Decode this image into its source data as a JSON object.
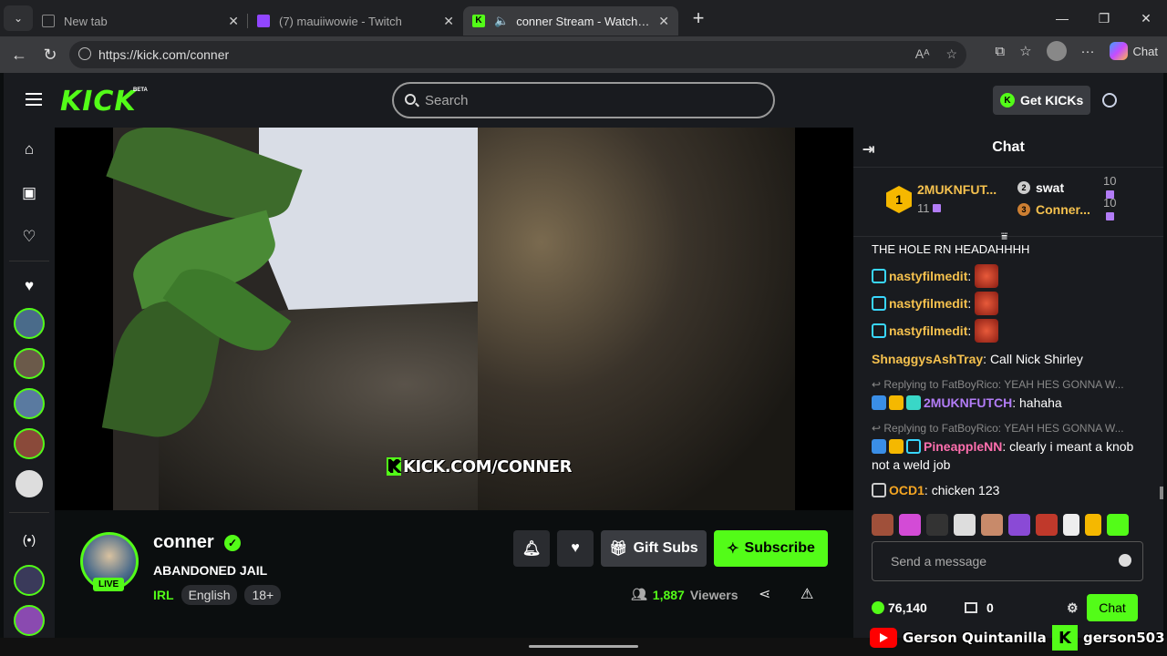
{
  "browser": {
    "tabs": [
      {
        "title": "New tab",
        "fav_color": "#5f6368",
        "active": false
      },
      {
        "title": "(7) mauiiwowie - Twitch",
        "fav_color": "#9146ff",
        "active": false
      },
      {
        "title": "conner Stream - Watch Live o",
        "fav_color": "#53fc18",
        "active": true
      }
    ],
    "url": "https://kick.com/conner",
    "copilot_label": "Chat",
    "icons": [
      "back-icon",
      "refresh-icon",
      "read-aloud-icon",
      "favorite-icon",
      "extensions-icon",
      "favorites-bar-icon",
      "profile-icon",
      "more-icon"
    ]
  },
  "kick": {
    "logo": "KICK",
    "beta": "BETA",
    "search_placeholder": "Search",
    "get_kicks": "Get KICKs"
  },
  "channel": {
    "name": "conner",
    "stream_title": "ABANDONED JAIL",
    "live_badge": "LIVE",
    "category": "IRL",
    "tags": [
      "English",
      "18+"
    ],
    "gift_subs": "Gift Subs",
    "subscribe": "Subscribe",
    "viewers": "1,887",
    "viewers_label": "Viewers",
    "watermark": "KICK.COM/CONNER"
  },
  "chat": {
    "title": "Chat",
    "leaderboard": {
      "first": {
        "rank": "1",
        "name": "2MUKNFUT...",
        "count": "11"
      },
      "second": {
        "rank": "2",
        "name": "swat",
        "count": "10"
      },
      "third": {
        "rank": "3",
        "name": "Conner...",
        "count": "10"
      }
    },
    "messages": [
      {
        "type": "text",
        "text": "THE HOLE RN HEADAHHHH"
      },
      {
        "type": "emote",
        "user": "nastyfilmedit",
        "color": "#f5c14e"
      },
      {
        "type": "emote",
        "user": "nastyfilmedit",
        "color": "#f5c14e"
      },
      {
        "type": "emote",
        "user": "nastyfilmedit",
        "color": "#f5c14e"
      },
      {
        "type": "text_user",
        "user": "ShnaggysAshTray",
        "color": "#f5c14e",
        "text": "Call Nick Shirley"
      },
      {
        "type": "reply",
        "reply": "Replying to FatBoyRico: YEAH HES GONNA W...",
        "user": "2MUKNFUTCH",
        "color": "#b27cf6",
        "text": "hahaha"
      },
      {
        "type": "reply",
        "reply": "Replying to FatBoyRico: YEAH HES GONNA W...",
        "user": "PineappleNN",
        "color": "#ff6fae",
        "text": "clearly i meant a knob not a weld job"
      },
      {
        "type": "text_user",
        "user": "OCD1",
        "color": "#f5a623",
        "text": "chicken 123"
      }
    ],
    "send_placeholder": "Send a message",
    "points": "76,140",
    "store_count": "0",
    "chat_button": "Chat"
  },
  "overlay": {
    "youtube_name": "Gerson Quintanilla",
    "kick_name": "gerson503"
  }
}
